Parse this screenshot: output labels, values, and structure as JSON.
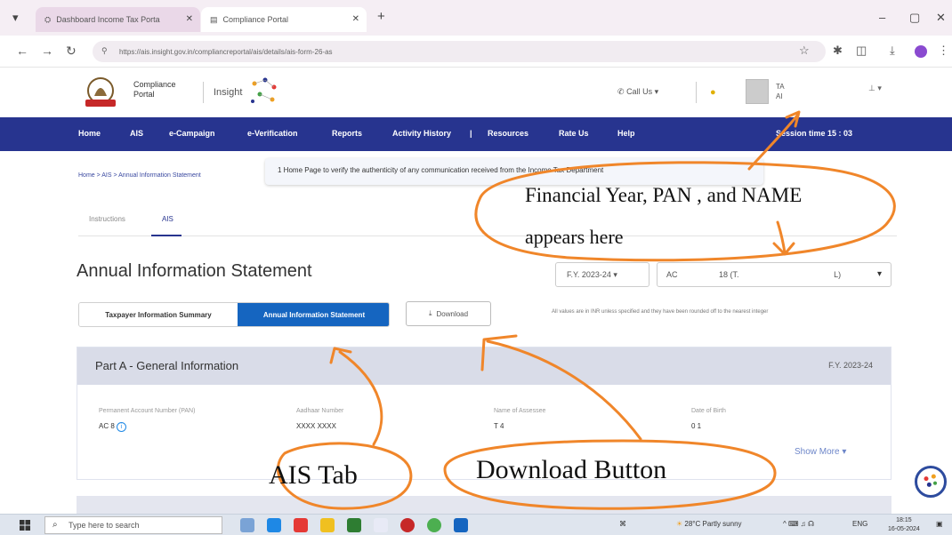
{
  "browser": {
    "tabs": [
      {
        "label": "Dashboard Income Tax Porta",
        "active": false
      },
      {
        "label": "Compliance Portal",
        "active": true
      }
    ],
    "url": "https://ais.insight.gov.in/compliancreportal/ais/details/ais-form-26-as"
  },
  "portal": {
    "logo_line1": "Compliance",
    "logo_line2": "Portal",
    "insight_label": "Insight",
    "call_us": "Call Us",
    "user_line1": "TA",
    "user_line2": "AI"
  },
  "nav": {
    "items": [
      "Home",
      "AIS",
      "e-Campaign",
      "e-Verification",
      "Reports",
      "Activity History",
      "|",
      "Resources",
      "Rate Us",
      "Help"
    ],
    "session": "Session time  15 : 03"
  },
  "breadcrumb": "Home > AIS > Annual Information Statement",
  "ticker": "1 Home Page to verify the authenticity of any communication received from the Income Tax Department",
  "subtabs": [
    "Instructions",
    "AIS"
  ],
  "page_title": "Annual Information Statement",
  "fy_select": "F.Y. 2023-24",
  "pan_select": {
    "prefix": "AC",
    "middle": "18 (T.",
    "suffix": "L)"
  },
  "segment": {
    "taxpayer": "Taxpayer Information Summary",
    "ais": "Annual Information Statement"
  },
  "download_label": "Download",
  "note": "All values are in INR unless specified and they have been rounded off to the nearest integer",
  "partA": {
    "title": "Part A - General Information",
    "fy": "F.Y. 2023-24",
    "fields": [
      {
        "label": "Permanent Account Number (PAN)",
        "value": "AC      8"
      },
      {
        "label": "Aadhaar Number",
        "value": "XXXX XXXX"
      },
      {
        "label": "Name of Assessee",
        "value": "T                 4"
      },
      {
        "label": "Date of Birth",
        "value": "0          1"
      }
    ],
    "show_more": "Show More"
  },
  "annotations": {
    "fy_line1": "Financial Year, PAN , and NAME",
    "fy_line2": "appears here",
    "ais_tab": "AIS Tab",
    "download_button": "Download Button",
    "color": "#f0862a"
  },
  "taskbar": {
    "search_placeholder": "Type here to search",
    "weather": "28°C  Partly sunny",
    "lang": "ENG",
    "time": "18:15",
    "date": "16-05-2024"
  },
  "colors": {
    "navbar": "#27348f",
    "accent_blue": "#1565c0",
    "annotation": "#f0862a"
  }
}
